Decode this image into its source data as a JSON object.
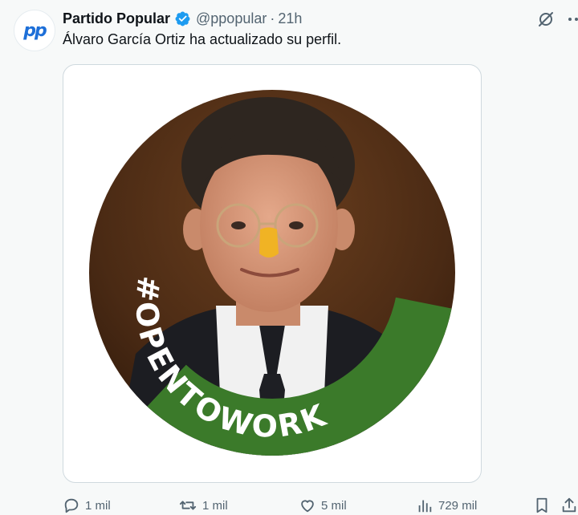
{
  "author": {
    "display_name": "Partido Popular",
    "handle": "@ppopular",
    "separator": "·",
    "timestamp": "21h",
    "verified": true,
    "avatar_text": "pp"
  },
  "tweet": {
    "text": "Álvaro García Ortiz ha actualizado su perfil."
  },
  "media": {
    "badge_text": "#OPENTOWORK",
    "ring_color": "#3b7a2a"
  },
  "actions": {
    "reply_count": "1 mil",
    "retweet_count": "1 mil",
    "like_count": "5 mil",
    "views_count": "729 mil"
  },
  "icons": {
    "verified": "verified-badge-icon",
    "grok": "grok-icon",
    "more": "more-icon",
    "reply": "reply-icon",
    "retweet": "retweet-icon",
    "like": "heart-icon",
    "views": "views-icon",
    "bookmark": "bookmark-icon",
    "share": "share-icon"
  },
  "colors": {
    "text_primary": "#0f1419",
    "text_secondary": "#536471",
    "verified_blue": "#1d9bf0",
    "background": "#f7f9f9"
  }
}
